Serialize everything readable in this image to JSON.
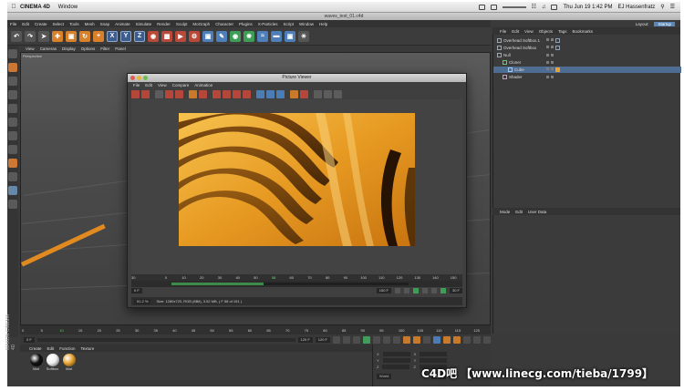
{
  "menubar": {
    "items": [
      "CINEMA 4D",
      "Window"
    ],
    "right_clock": "Thu Jun 19  1:42 PM",
    "user": "EJ Hassenfratz"
  },
  "app": {
    "title": "waves_test_01.c4d",
    "menu": [
      "File",
      "Edit",
      "Create",
      "Select",
      "Tools",
      "Mesh",
      "Snap",
      "Animate",
      "Simulate",
      "Render",
      "Sculpt",
      "MoGraph",
      "Character",
      "Plugins",
      "X-Particles",
      "Script",
      "Window",
      "Help"
    ],
    "layout_label": "Layout:",
    "layout_value": "Startup",
    "axis_buttons": [
      "X",
      "Y",
      "Z"
    ]
  },
  "viewport": {
    "menu": [
      "View",
      "Cameras",
      "Display",
      "Options",
      "Filter",
      "Panel"
    ],
    "label": "Perspective"
  },
  "picture_viewer": {
    "title": "Picture Viewer",
    "menu": [
      "File",
      "Edit",
      "View",
      "Compare",
      "Animation"
    ],
    "ruler": [
      "0",
      "10",
      "20",
      "30",
      "40",
      "50",
      "60",
      "70",
      "80",
      "90",
      "100",
      "110",
      "120",
      "130",
      "140",
      "150"
    ],
    "current_frame_label": "58",
    "progress": 0.39,
    "left_frame": "30",
    "frame_field": "0 F",
    "end_frame_field": "150 F",
    "fps_field": "30 F",
    "zoom": "51.2 %",
    "status": "Size: 1280x720, RGB (8Bit), 3.52 MB,  ( F 58 of 151 )"
  },
  "objects": {
    "menu": [
      "File",
      "Edit",
      "View",
      "Objects",
      "Tags",
      "Bookmarks"
    ],
    "rows": [
      {
        "name": "Overhead Softbox.1",
        "indent": 0
      },
      {
        "name": "Overhead Softbox",
        "indent": 0
      },
      {
        "name": "Null",
        "indent": 0
      },
      {
        "name": "Cloner",
        "indent": 1
      },
      {
        "name": "Cube",
        "indent": 2
      },
      {
        "name": "Shader",
        "indent": 1
      }
    ]
  },
  "attributes": {
    "menu": [
      "Mode",
      "Edit",
      "User Data"
    ]
  },
  "timeline": {
    "ticks": [
      "0",
      "5",
      "10",
      "15",
      "20",
      "25",
      "30",
      "35",
      "40",
      "45",
      "50",
      "55",
      "60",
      "65",
      "70",
      "75",
      "80",
      "85",
      "90",
      "95",
      "100",
      "105",
      "110",
      "115",
      "120"
    ],
    "current": "10",
    "start_field": "0 F",
    "end_field": "120 F",
    "out_field": "120 F"
  },
  "materials": {
    "menu": [
      "Create",
      "Edit",
      "Function",
      "Texture"
    ],
    "items": [
      {
        "name": "Mat",
        "color": "#111111"
      },
      {
        "name": "Softbox",
        "color": "#f0f0f0"
      },
      {
        "name": "Mat",
        "color": "#e8a230"
      }
    ]
  },
  "coordinates": {
    "rows": [
      "X",
      "Y",
      "Z"
    ],
    "apply": "Apply",
    "mode": "World"
  },
  "left_logo": "MAXON CINEMA 4D",
  "watermark": {
    "brand": "C4D吧",
    "text": "【www.linecg.com/tieba/1799】"
  },
  "colors": {
    "accent_orange": "#e8a230",
    "ui_bg": "#3a3a3a",
    "select_blue": "#4f6d92"
  }
}
